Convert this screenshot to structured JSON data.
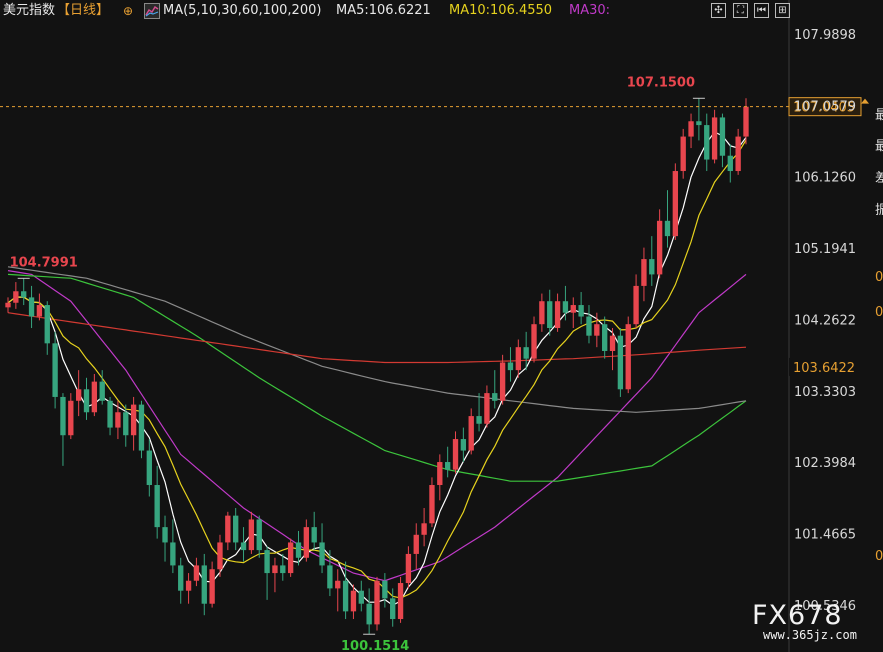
{
  "header": {
    "instrument": "美元指数",
    "period": "【日线】",
    "add_icon": "plus-circle-icon",
    "ma_icon": "line-chart-icon",
    "ma_label": "MA(5,10,30,60,100,200)",
    "ma5_label": "MA5:106.6221",
    "ma10_label": "MA10:106.4550",
    "ma30_label": "MA30:",
    "tools": [
      "crosshair-icon",
      "maximize-icon",
      "step-back-icon",
      "grid-icon"
    ]
  },
  "colors": {
    "background": "#121212",
    "up": "#e8464e",
    "down": "#37a57f",
    "ma5": "#ffffff",
    "ma10": "#e6d21e",
    "ma30": "#c03ac8",
    "ma60": "#3cc43c",
    "ma100": "#8a8a8a",
    "ma200": "#d23a32",
    "price_line": "#e6a032"
  },
  "watermark": {
    "brand": "FX678",
    "site": "www.365jz.com"
  },
  "right_edge_chars": [
    "最",
    "最",
    "差",
    "振",
    "0",
    "0",
    "0"
  ],
  "chart_data": {
    "type": "candlestick",
    "title": "美元指数 日线",
    "y_ticks": [
      107.9898,
      107.0579,
      106.126,
      105.1941,
      104.2622,
      103.3303,
      102.3984,
      101.4665,
      100.5346
    ],
    "ylim": [
      100.05,
      108.12
    ],
    "current_price": 107.0405,
    "reference_price": 103.6422,
    "annotations": [
      {
        "label": "107.1500",
        "value": 107.15,
        "kind": "high"
      },
      {
        "label": "104.7991",
        "value": 104.7991,
        "kind": "high"
      },
      {
        "label": "100.1514",
        "value": 100.1514,
        "kind": "low"
      }
    ],
    "ohlc": [
      [
        104.42,
        104.55,
        104.35,
        104.48
      ],
      [
        104.48,
        104.75,
        104.4,
        104.63
      ],
      [
        104.63,
        104.8,
        104.45,
        104.55
      ],
      [
        104.55,
        104.7,
        104.15,
        104.3
      ],
      [
        104.3,
        104.6,
        104.25,
        104.45
      ],
      [
        104.45,
        104.5,
        103.8,
        103.95
      ],
      [
        103.95,
        104.1,
        103.1,
        103.25
      ],
      [
        103.25,
        103.3,
        102.35,
        102.75
      ],
      [
        102.75,
        103.3,
        102.7,
        103.2
      ],
      [
        103.2,
        103.6,
        103.0,
        103.35
      ],
      [
        103.35,
        103.5,
        102.95,
        103.05
      ],
      [
        103.05,
        103.55,
        103.0,
        103.45
      ],
      [
        103.45,
        103.6,
        103.15,
        103.2
      ],
      [
        103.2,
        103.25,
        102.75,
        102.85
      ],
      [
        102.85,
        103.2,
        102.7,
        103.05
      ],
      [
        103.05,
        103.15,
        102.6,
        102.75
      ],
      [
        102.75,
        103.25,
        102.55,
        103.15
      ],
      [
        103.15,
        103.2,
        102.45,
        102.55
      ],
      [
        102.55,
        102.7,
        101.95,
        102.1
      ],
      [
        102.1,
        102.35,
        101.4,
        101.55
      ],
      [
        101.55,
        101.7,
        101.1,
        101.35
      ],
      [
        101.35,
        101.65,
        100.95,
        101.05
      ],
      [
        101.05,
        101.15,
        100.55,
        100.72
      ],
      [
        100.72,
        100.95,
        100.55,
        100.85
      ],
      [
        100.85,
        101.15,
        100.78,
        101.05
      ],
      [
        101.05,
        101.2,
        100.4,
        100.55
      ],
      [
        100.55,
        101.1,
        100.5,
        101.0
      ],
      [
        101.0,
        101.45,
        100.9,
        101.35
      ],
      [
        101.35,
        101.75,
        101.25,
        101.7
      ],
      [
        101.7,
        101.8,
        101.25,
        101.35
      ],
      [
        101.35,
        101.55,
        101.1,
        101.25
      ],
      [
        101.25,
        101.75,
        101.2,
        101.65
      ],
      [
        101.65,
        101.7,
        101.15,
        101.25
      ],
      [
        101.25,
        101.3,
        100.6,
        100.95
      ],
      [
        100.95,
        101.15,
        100.7,
        101.05
      ],
      [
        101.05,
        101.2,
        100.85,
        100.95
      ],
      [
        100.95,
        101.4,
        100.9,
        101.35
      ],
      [
        101.35,
        101.5,
        101.05,
        101.15
      ],
      [
        101.15,
        101.65,
        101.1,
        101.55
      ],
      [
        101.55,
        101.75,
        101.25,
        101.35
      ],
      [
        101.35,
        101.6,
        100.95,
        101.05
      ],
      [
        101.05,
        101.25,
        100.65,
        100.75
      ],
      [
        100.75,
        101.0,
        100.45,
        100.85
      ],
      [
        100.85,
        101.1,
        100.35,
        100.45
      ],
      [
        100.45,
        100.8,
        100.35,
        100.72
      ],
      [
        100.72,
        100.85,
        100.45,
        100.55
      ],
      [
        100.55,
        100.75,
        100.15,
        100.28
      ],
      [
        100.28,
        100.9,
        100.2,
        100.85
      ],
      [
        100.85,
        100.95,
        100.5,
        100.62
      ],
      [
        100.62,
        100.75,
        100.25,
        100.35
      ],
      [
        100.35,
        100.9,
        100.3,
        100.82
      ],
      [
        100.82,
        101.3,
        100.75,
        101.2
      ],
      [
        101.2,
        101.6,
        101.0,
        101.45
      ],
      [
        101.45,
        101.8,
        101.3,
        101.6
      ],
      [
        101.6,
        102.2,
        101.55,
        102.1
      ],
      [
        102.1,
        102.5,
        101.9,
        102.4
      ],
      [
        102.4,
        102.6,
        102.2,
        102.3
      ],
      [
        102.3,
        102.8,
        102.25,
        102.7
      ],
      [
        102.7,
        102.85,
        102.4,
        102.55
      ],
      [
        102.55,
        103.1,
        102.5,
        103.0
      ],
      [
        103.0,
        103.3,
        102.8,
        102.9
      ],
      [
        102.9,
        103.4,
        102.85,
        103.3
      ],
      [
        103.3,
        103.6,
        103.1,
        103.2
      ],
      [
        103.2,
        103.8,
        103.15,
        103.7
      ],
      [
        103.7,
        103.9,
        103.45,
        103.6
      ],
      [
        103.6,
        104.0,
        103.5,
        103.9
      ],
      [
        103.9,
        104.1,
        103.6,
        103.75
      ],
      [
        103.75,
        104.3,
        103.7,
        104.2
      ],
      [
        104.2,
        104.6,
        104.1,
        104.5
      ],
      [
        104.5,
        104.65,
        104.05,
        104.15
      ],
      [
        104.15,
        104.6,
        104.1,
        104.5
      ],
      [
        104.5,
        104.7,
        104.25,
        104.35
      ],
      [
        104.35,
        104.55,
        104.15,
        104.45
      ],
      [
        104.45,
        104.62,
        104.2,
        104.3
      ],
      [
        104.3,
        104.45,
        103.95,
        104.05
      ],
      [
        104.05,
        104.35,
        103.9,
        104.2
      ],
      [
        104.2,
        104.3,
        103.75,
        103.85
      ],
      [
        103.85,
        104.15,
        103.6,
        104.05
      ],
      [
        104.05,
        104.15,
        103.25,
        103.35
      ],
      [
        103.35,
        104.3,
        103.3,
        104.2
      ],
      [
        104.2,
        104.85,
        104.15,
        104.7
      ],
      [
        104.7,
        105.2,
        104.5,
        105.05
      ],
      [
        105.05,
        105.35,
        104.7,
        104.85
      ],
      [
        104.85,
        105.7,
        104.8,
        105.55
      ],
      [
        105.55,
        105.95,
        105.2,
        105.35
      ],
      [
        105.35,
        106.3,
        105.3,
        106.2
      ],
      [
        106.2,
        106.75,
        106.1,
        106.65
      ],
      [
        106.65,
        106.95,
        106.5,
        106.85
      ],
      [
        106.85,
        107.15,
        106.6,
        106.8
      ],
      [
        106.8,
        106.95,
        106.2,
        106.35
      ],
      [
        106.35,
        107.0,
        106.3,
        106.9
      ],
      [
        106.9,
        106.95,
        106.25,
        106.4
      ],
      [
        106.4,
        106.55,
        106.05,
        106.2
      ],
      [
        106.2,
        106.75,
        106.15,
        106.65
      ],
      [
        106.65,
        107.15,
        106.55,
        107.04
      ]
    ],
    "ma_series": [
      {
        "name": "MA5",
        "period": 5
      },
      {
        "name": "MA10",
        "period": 10
      },
      {
        "name": "MA30",
        "period": 30
      },
      {
        "name": "MA60",
        "period": 60
      },
      {
        "name": "MA100",
        "period": 100
      },
      {
        "name": "MA200",
        "period": 200
      }
    ],
    "ma_long_points": {
      "MA30": [
        [
          0,
          104.9
        ],
        [
          3,
          104.85
        ],
        [
          8,
          104.5
        ],
        [
          15,
          103.6
        ],
        [
          22,
          102.5
        ],
        [
          30,
          101.8
        ],
        [
          38,
          101.25
        ],
        [
          44,
          100.95
        ],
        [
          48,
          100.85
        ],
        [
          55,
          101.1
        ],
        [
          62,
          101.55
        ],
        [
          70,
          102.2
        ],
        [
          76,
          102.85
        ],
        [
          82,
          103.5
        ],
        [
          88,
          104.35
        ],
        [
          94,
          104.85
        ]
      ],
      "MA60": [
        [
          0,
          104.85
        ],
        [
          8,
          104.8
        ],
        [
          16,
          104.55
        ],
        [
          24,
          104.05
        ],
        [
          32,
          103.5
        ],
        [
          40,
          103.0
        ],
        [
          48,
          102.55
        ],
        [
          56,
          102.3
        ],
        [
          64,
          102.15
        ],
        [
          70,
          102.15
        ],
        [
          76,
          102.25
        ],
        [
          82,
          102.35
        ],
        [
          88,
          102.75
        ],
        [
          94,
          103.2
        ]
      ],
      "MA100": [
        [
          0,
          104.95
        ],
        [
          10,
          104.8
        ],
        [
          20,
          104.5
        ],
        [
          30,
          104.05
        ],
        [
          40,
          103.65
        ],
        [
          48,
          103.45
        ],
        [
          56,
          103.3
        ],
        [
          64,
          103.2
        ],
        [
          72,
          103.1
        ],
        [
          80,
          103.05
        ],
        [
          88,
          103.1
        ],
        [
          94,
          103.2
        ]
      ],
      "MA200": [
        [
          0,
          104.35
        ],
        [
          10,
          104.2
        ],
        [
          20,
          104.05
        ],
        [
          30,
          103.9
        ],
        [
          40,
          103.75
        ],
        [
          48,
          103.7
        ],
        [
          56,
          103.7
        ],
        [
          64,
          103.72
        ],
        [
          72,
          103.75
        ],
        [
          80,
          103.8
        ],
        [
          88,
          103.86
        ],
        [
          94,
          103.9
        ]
      ]
    }
  }
}
